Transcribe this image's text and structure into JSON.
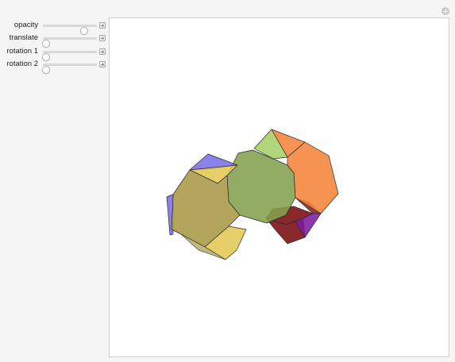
{
  "controls": [
    {
      "label": "opacity",
      "value": 0.8
    },
    {
      "label": "translate",
      "value": 0.0
    },
    {
      "label": "rotation 1",
      "value": 0.0
    },
    {
      "label": "rotation 2",
      "value": 0.0
    }
  ],
  "colors": {
    "panel_bg": "#f5f5f5",
    "canvas_bg": "#ffffff",
    "hex_left": "#a99a46",
    "hex_right": "#84a04f",
    "octagon": "#f5843b",
    "triangle_blue": "#7b6fe6",
    "triangle_yellow": "#e2c854",
    "triangle_green": "#a6cf66",
    "dark_red": "#7a0a10",
    "purple": "#7e1aa0"
  }
}
